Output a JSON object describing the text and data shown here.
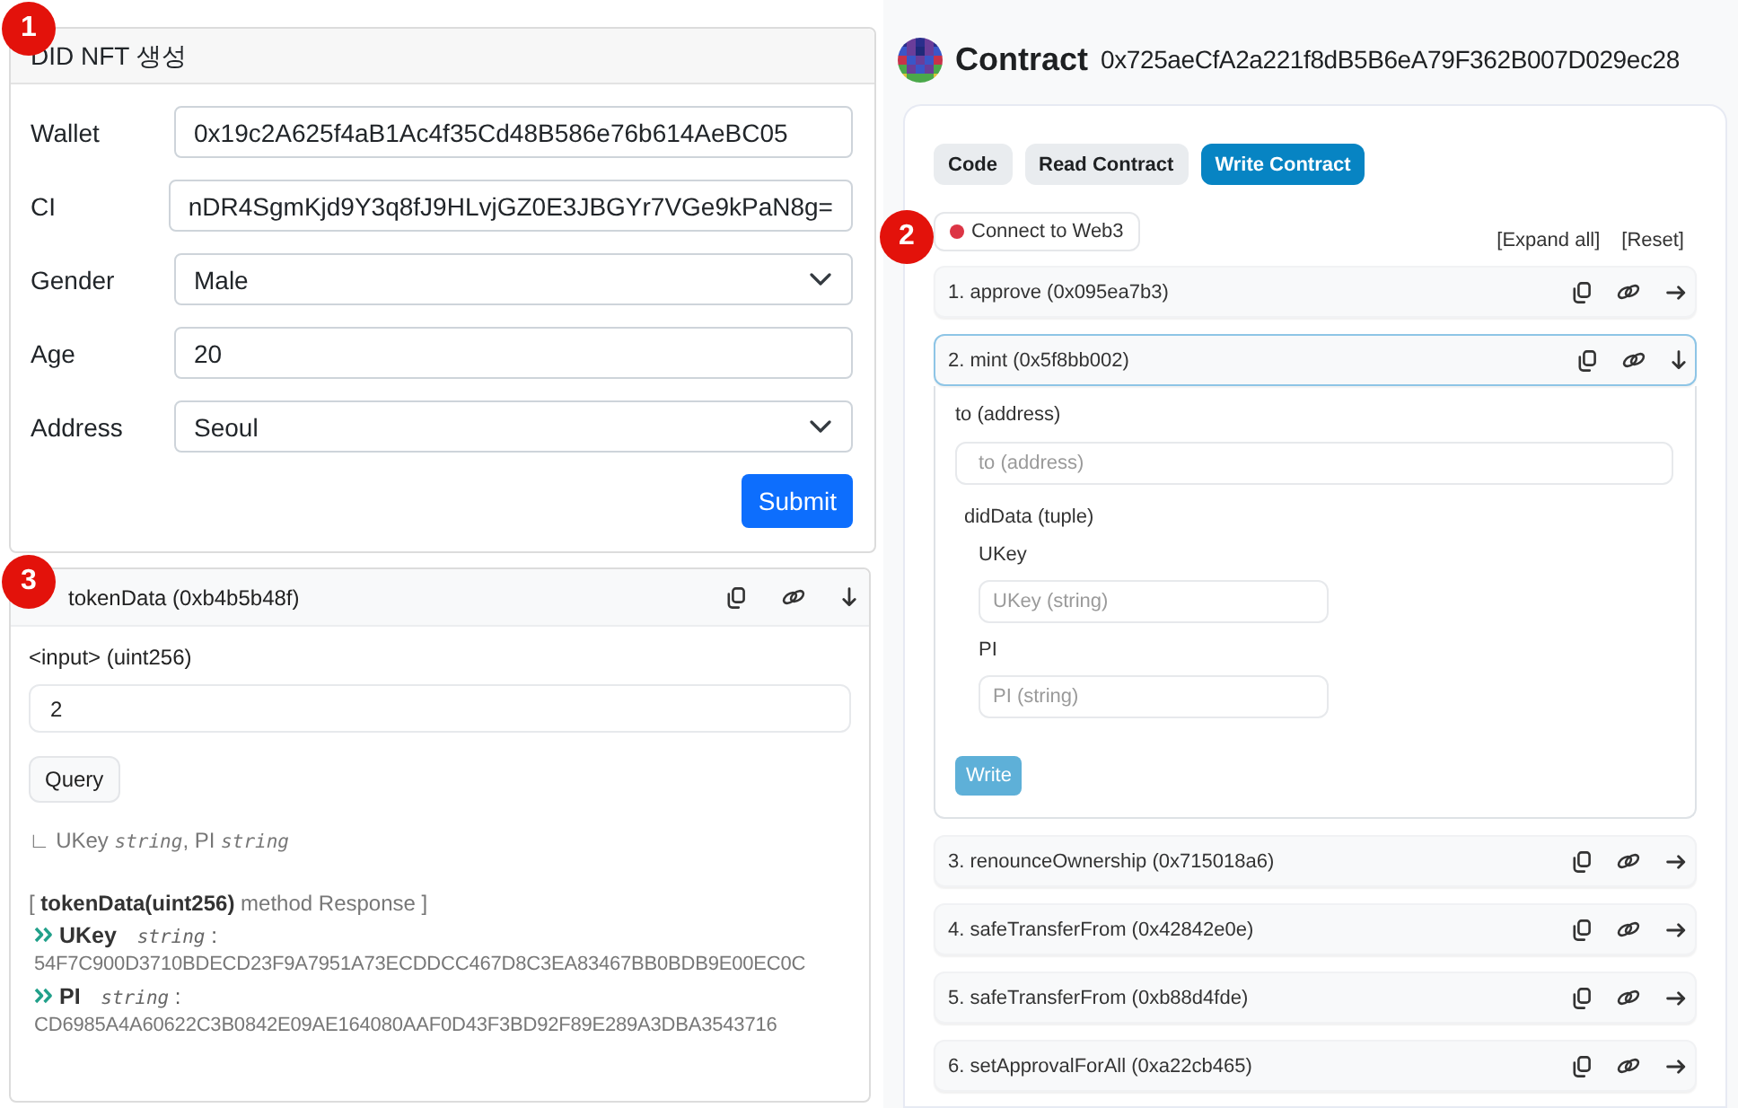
{
  "did_form": {
    "badge": "1",
    "title": "DID NFT 생성",
    "fields": [
      {
        "kind": "text",
        "label": "Wallet",
        "value": "0x19c2A625f4aB1Ac4f35Cd48B586e76b614AeBC05"
      },
      {
        "kind": "text",
        "label": "CI",
        "value": "nDR4SgmKjd9Y3q8fJ9HLvjGZ0E3JBGYr7VGe9kPaN8g="
      },
      {
        "kind": "select",
        "label": "Gender",
        "value": "Male"
      },
      {
        "kind": "text",
        "label": "Age",
        "value": "20"
      },
      {
        "kind": "select",
        "label": "Address",
        "value": "Seoul"
      }
    ],
    "submit": "Submit"
  },
  "query_panel": {
    "badge": "3",
    "title": "tokenData (0xb4b5b48f)",
    "expanded": true,
    "input_label": "<input> (uint256)",
    "input_value": "2",
    "query_button": "Query",
    "outputs": "∟ UKey *string*, PI *string*",
    "response_title": "[ **tokenData(uint256)** method Response ]",
    "results": [
      {
        "heading": "**UKey** *string* :",
        "value": "54F7C900D3710BDECD23F9A7951A73ECDDCC467D8C3EA83467BB0BDB9E00EC0C"
      },
      {
        "heading": "**PI** *string* :",
        "value": "CD6985A4A60622C3B0842E09AE164080AAF0D43F3BD92F89E289A3DBA3543716"
      }
    ]
  },
  "contract": {
    "title": "Contract",
    "address": "0x725aeCfA2a221f8dB5B6eA79F362B007D029ec28",
    "tabs": [
      {
        "label": "Code",
        "selected": false
      },
      {
        "label": "Read Contract",
        "selected": false
      },
      {
        "label": "Write Contract",
        "selected": true
      }
    ],
    "badge": "2",
    "connect_button": "Connect to Web3",
    "connected": false,
    "links": [
      "[Expand all]",
      "[Reset]"
    ],
    "functions": [
      {
        "label": "1. approve (0x095ea7b3)",
        "expanded": false
      },
      {
        "label": "2. mint (0x5f8bb002)",
        "expanded": true,
        "params": [
          {
            "kind": "field",
            "label": "to (address)",
            "placeholder": "to (address)"
          },
          {
            "kind": "tuple",
            "label": "didData (tuple)",
            "children": [
              {
                "label": "UKey",
                "placeholder": "UKey (string)"
              },
              {
                "label": "PI",
                "placeholder": "PI (string)"
              }
            ]
          }
        ],
        "write_button": "Write"
      },
      {
        "label": "3. renounceOwnership (0x715018a6)",
        "expanded": false
      },
      {
        "label": "4. safeTransferFrom (0x42842e0e)",
        "expanded": false
      },
      {
        "label": "5. safeTransferFrom (0xb88d4fde)",
        "expanded": false
      },
      {
        "label": "6. setApprovalForAll (0xa22cb465)",
        "expanded": false
      }
    ]
  }
}
